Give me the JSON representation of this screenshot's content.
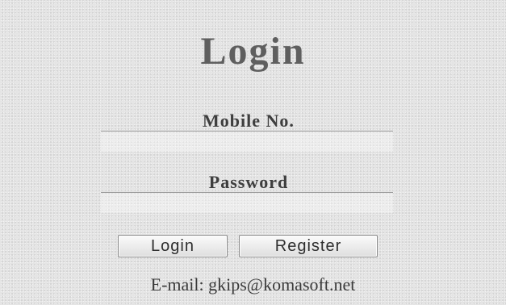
{
  "form": {
    "title": "Login",
    "mobile_label": "Mobile No.",
    "mobile_value": "",
    "password_label": "Password",
    "password_value": "",
    "login_button": "Login",
    "register_button": "Register",
    "email_text": "E-mail: gkips@komasoft.net"
  }
}
